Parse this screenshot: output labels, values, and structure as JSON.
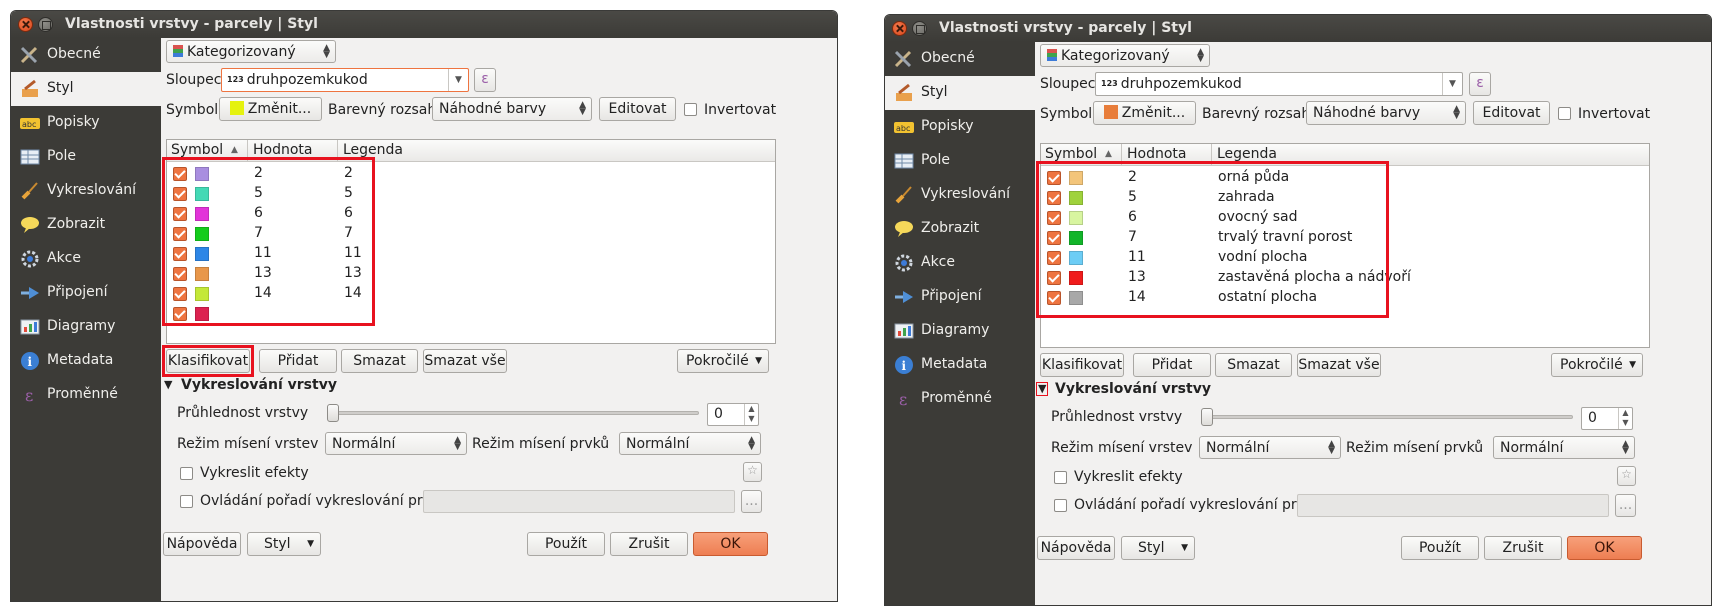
{
  "windows": [
    {
      "title": "Vlastnosti vrstvy - parcely | Styl",
      "sidebar": [
        {
          "label": "Obecné",
          "icon": "tools-icon"
        },
        {
          "label": "Styl",
          "icon": "paintbrush-icon"
        },
        {
          "label": "Popisky",
          "icon": "abc-label-icon"
        },
        {
          "label": "Pole",
          "icon": "table-fields-icon"
        },
        {
          "label": "Vykreslování",
          "icon": "brush-icon"
        },
        {
          "label": "Zobrazit",
          "icon": "speech-bubble-icon"
        },
        {
          "label": "Akce",
          "icon": "gear-action-icon"
        },
        {
          "label": "Připojení",
          "icon": "join-icon"
        },
        {
          "label": "Diagramy",
          "icon": "diagram-icon"
        },
        {
          "label": "Metadata",
          "icon": "info-icon"
        },
        {
          "label": "Proměnné",
          "icon": "epsilon-icon"
        }
      ],
      "renderer": "Kategorizovaný",
      "column_label": "Sloupec",
      "column_value": "druhpozemkukod",
      "column_prefix": "123",
      "expr_button": "ε",
      "symbol_label": "Symbol",
      "symbol_button": "Změnit...",
      "symbol_color": "#e5f20f",
      "ramp_label": "Barevný rozsah",
      "ramp_value": "Náhodné barvy",
      "edit_button": "Editovat",
      "invert_label": "Invertovat",
      "table_headers": {
        "symbol": "Symbol",
        "value": "Hodnota",
        "legend": "Legenda"
      },
      "rows": [
        {
          "color": "#a98ee0",
          "value": "2",
          "legend": "2"
        },
        {
          "color": "#43d9b5",
          "value": "5",
          "legend": "5"
        },
        {
          "color": "#e234d9",
          "value": "6",
          "legend": "6"
        },
        {
          "color": "#14cc1c",
          "value": "7",
          "legend": "7"
        },
        {
          "color": "#2d86e6",
          "value": "11",
          "legend": "11"
        },
        {
          "color": "#e8974a",
          "value": "13",
          "legend": "13"
        },
        {
          "color": "#c4e838",
          "value": "14",
          "legend": "14"
        },
        {
          "color": "#dc2250",
          "value": "",
          "legend": ""
        }
      ],
      "buttons": {
        "classify": "Klasifikovat",
        "add": "Přidat",
        "delete": "Smazat",
        "delete_all": "Smazat vše",
        "advanced": "Pokročilé"
      },
      "section_title": "Vykreslování vrstvy",
      "transparency_label": "Průhlednost vrstvy",
      "transparency_value": "0",
      "blend_layer_label": "Režim mísení vrstev",
      "blend_layer_value": "Normální",
      "blend_feature_label": "Režim mísení prvků",
      "blend_feature_value": "Normální",
      "effects_label": "Vykreslit efekty",
      "order_label": "Ovládání pořadí vykreslování prvků",
      "order_button": "...",
      "footer": {
        "help": "Nápověda",
        "style": "Styl",
        "apply": "Použít",
        "cancel": "Zrušit",
        "ok": "OK"
      }
    },
    {
      "title": "Vlastnosti vrstvy - parcely | Styl",
      "sidebar": [
        {
          "label": "Obecné",
          "icon": "tools-icon"
        },
        {
          "label": "Styl",
          "icon": "paintbrush-icon"
        },
        {
          "label": "Popisky",
          "icon": "abc-label-icon"
        },
        {
          "label": "Pole",
          "icon": "table-fields-icon"
        },
        {
          "label": "Vykreslování",
          "icon": "brush-icon"
        },
        {
          "label": "Zobrazit",
          "icon": "speech-bubble-icon"
        },
        {
          "label": "Akce",
          "icon": "gear-action-icon"
        },
        {
          "label": "Připojení",
          "icon": "join-icon"
        },
        {
          "label": "Diagramy",
          "icon": "diagram-icon"
        },
        {
          "label": "Metadata",
          "icon": "info-icon"
        },
        {
          "label": "Proměnné",
          "icon": "epsilon-icon"
        }
      ],
      "renderer": "Kategorizovaný",
      "column_label": "Sloupec",
      "column_value": "druhpozemkukod",
      "column_prefix": "123",
      "expr_button": "ε",
      "symbol_label": "Symbol",
      "symbol_button": "Změnit...",
      "symbol_color": "#e87d3a",
      "ramp_label": "Barevný rozsah",
      "ramp_value": "Náhodné barvy",
      "edit_button": "Editovat",
      "invert_label": "Invertovat",
      "table_headers": {
        "symbol": "Symbol",
        "value": "Hodnota",
        "legend": "Legenda"
      },
      "rows": [
        {
          "color": "#f3c57a",
          "value": "2",
          "legend": "orná půda"
        },
        {
          "color": "#9fd23c",
          "value": "5",
          "legend": "zahrada"
        },
        {
          "color": "#d8f5a0",
          "value": "6",
          "legend": "ovocný sad"
        },
        {
          "color": "#12b52a",
          "value": "7",
          "legend": "trvalý travní porost"
        },
        {
          "color": "#6dcdf5",
          "value": "11",
          "legend": "vodní plocha"
        },
        {
          "color": "#f01c1c",
          "value": "13",
          "legend": "zastavěná plocha a nádvoří"
        },
        {
          "color": "#a8a8a8",
          "value": "14",
          "legend": "ostatní plocha"
        }
      ],
      "buttons": {
        "classify": "Klasifikovat",
        "add": "Přidat",
        "delete": "Smazat",
        "delete_all": "Smazat vše",
        "advanced": "Pokročilé"
      },
      "section_title": "Vykreslování vrstvy",
      "transparency_label": "Průhlednost vrstvy",
      "transparency_value": "0",
      "blend_layer_label": "Režim mísení vrstev",
      "blend_layer_value": "Normální",
      "blend_feature_label": "Režim mísení prvků",
      "blend_feature_value": "Normální",
      "effects_label": "Vykreslit efekty",
      "order_label": "Ovládání pořadí vykreslování prvků",
      "order_button": "...",
      "footer": {
        "help": "Nápověda",
        "style": "Styl",
        "apply": "Použít",
        "cancel": "Zrušit",
        "ok": "OK"
      }
    }
  ],
  "colors": {
    "highlight": "#e8121f",
    "sidebar_bg": "#3c3b37",
    "checkbox_accent": "#ee7440",
    "ok_button": "#ee7e52"
  }
}
